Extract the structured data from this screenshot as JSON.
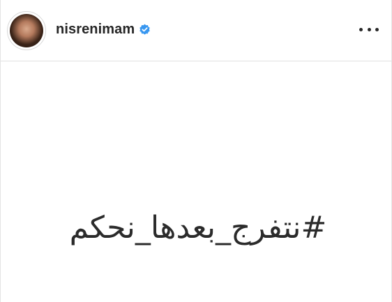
{
  "post_header": {
    "username": "nisrenimam",
    "verified_icon": "verified-badge-icon",
    "verified_color": "#3897f0",
    "more_icon": "more-options-icon"
  },
  "post": {
    "hashtag_text": "#نتفرج_بعدها_نحكم",
    "background": "#ffffff"
  }
}
